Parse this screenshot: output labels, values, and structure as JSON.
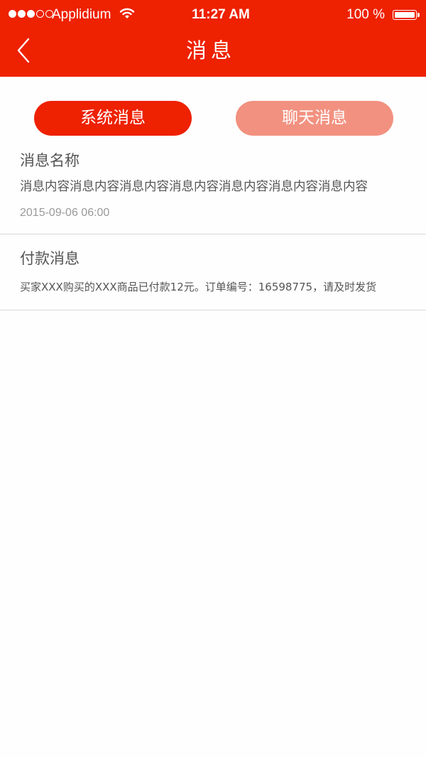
{
  "status_bar": {
    "carrier": "Applidium",
    "time": "11:27 AM",
    "battery": "100 %"
  },
  "nav": {
    "title": "消息",
    "back_icon": "chevron-left-icon"
  },
  "tabs": [
    {
      "label": "系统消息",
      "active": true
    },
    {
      "label": "聊天消息",
      "active": false
    }
  ],
  "messages": [
    {
      "title": "消息名称",
      "content": "消息内容消息内容消息内容消息内容消息内容消息内容消息内容",
      "time": "2015-09-06 06:00"
    },
    {
      "title": "付款消息",
      "content": "买家XXX购买的XXX商品已付款12元。订单编号：16598775，请及时发货"
    }
  ],
  "colors": {
    "accent": "#ee2100",
    "inactive_tab": "#f29180",
    "text": "#555555",
    "muted_text": "#999999",
    "divider": "#d9d9d9"
  }
}
